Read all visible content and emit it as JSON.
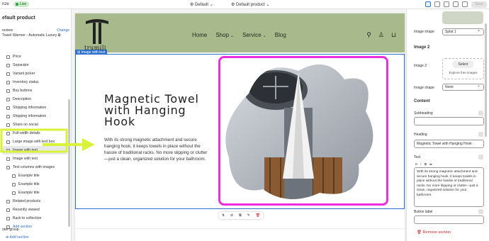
{
  "topbar": {
    "app": "nze",
    "live": "Live",
    "theme": "Default",
    "template": "Default product",
    "save": "Save"
  },
  "left": {
    "title": "efault product",
    "preview_label": "review",
    "change": "Change",
    "product": "Towel Warmer - Automatic Luxury",
    "items": [
      {
        "label": "Price",
        "child": false
      },
      {
        "label": "Separator",
        "child": false
      },
      {
        "label": "Variant picker",
        "child": false
      },
      {
        "label": "Inventory status",
        "child": false
      },
      {
        "label": "Buy buttons",
        "child": false
      },
      {
        "label": "Description",
        "child": false
      },
      {
        "label": "Shipping information",
        "child": false
      },
      {
        "label": "Shipping information",
        "child": false
      },
      {
        "label": "Share on social",
        "child": false
      },
      {
        "label": "Full-width details",
        "child": false
      },
      {
        "label": "Large image with text box",
        "child": false
      },
      {
        "label": "Image with text",
        "child": false,
        "selected": true
      },
      {
        "label": "Image with text",
        "child": false
      },
      {
        "label": "Text columns with images",
        "child": false
      },
      {
        "label": "Example title",
        "child": true
      },
      {
        "label": "Example title",
        "child": true
      },
      {
        "label": "Example title",
        "child": true
      },
      {
        "label": "Related products",
        "child": false
      },
      {
        "label": "Recently viewed",
        "child": false
      },
      {
        "label": "Back to collection",
        "child": false
      },
      {
        "label": "Add section",
        "child": false,
        "blue": true
      }
    ],
    "footer": "oter group",
    "footer_add": "Add section"
  },
  "store": {
    "logo": "trumili",
    "nav": [
      "Home",
      "Shop",
      "Service",
      "Blog"
    ],
    "section_tag": "Image with text",
    "heading": "Magnetic Towel with Hanging Hook",
    "body": "With its strong magnetic attachment and secure hanging hook, it keeps towels in place without the hassle of traditional racks. No more slipping or clutter—just a clean, organized solution for your bathroom."
  },
  "right": {
    "image_shape_label": "Image shape",
    "image_shape_value": "Splat 1",
    "image2_title": "Image 2",
    "image2_label": "Image 2",
    "select": "Select",
    "explore": "Explore free images",
    "image_shape2_value": "None",
    "content_title": "Content",
    "subheading": "Subheading",
    "heading_label": "Heading",
    "heading_value": "Magnetic Towel with Hanging Hook",
    "text_label": "Text",
    "text_value": "With its strong magnetic attachment and secure hanging hook, it keeps towels in place without the hassle of traditional racks. No more slipping or clutter—just a clean, organized solution for your bathroom.",
    "button_label": "Button label",
    "remove": "Remove section"
  },
  "colors": {
    "header": "#a8b98c",
    "accent": "#2c6ecb",
    "highlight": "#ee2de0",
    "annotation": "#d9f23a"
  }
}
